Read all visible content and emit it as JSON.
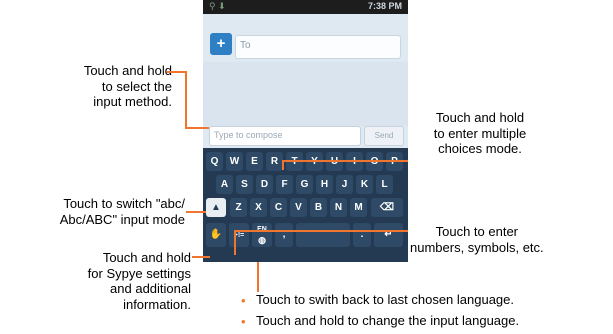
{
  "phone": {
    "status_time": "7:38 PM",
    "to_label": "To",
    "compose_placeholder": "Type to compose",
    "send_label": "Send",
    "contact_icon": "+",
    "keyboard": {
      "row1": [
        "Q",
        "W",
        "E",
        "R",
        "T",
        "Y",
        "U",
        "I",
        "O",
        "P"
      ],
      "row2": [
        "A",
        "S",
        "D",
        "F",
        "G",
        "H",
        "J",
        "K",
        "L"
      ],
      "row3": [
        "Z",
        "X",
        "C",
        "V",
        "B",
        "N",
        "M"
      ],
      "shift_icon": "shift-icon",
      "delete_icon": "backspace-icon",
      "numbers_key": "+!=",
      "lang_key": "EN",
      "comma": ",",
      "period": ".",
      "enter_icon": "enter-icon"
    }
  },
  "annotations": {
    "input_method": [
      "Touch and hold",
      "to select the",
      "input method."
    ],
    "multiple_choices": [
      "Touch and hold",
      "to enter multiple",
      "choices mode."
    ],
    "switch_case": [
      "Touch to switch \"abc/",
      "Abc/ABC\" input mode"
    ],
    "numbers_symbols": [
      "Touch to enter",
      "numbers, symbols, etc."
    ],
    "settings": [
      "Touch and hold",
      "for Sypye settings",
      "and additional",
      "information."
    ],
    "language_back": "Touch to swith back to last chosen language.",
    "language_change": "Touch and hold to change the input language."
  },
  "colors": {
    "leader": "#f0762f",
    "keyboard": "#233a52"
  }
}
